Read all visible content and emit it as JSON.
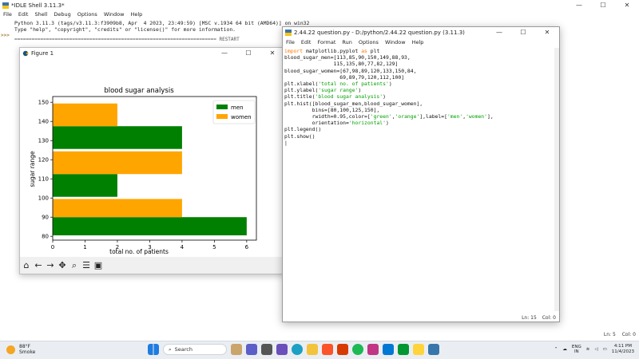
{
  "shell": {
    "title": "*IDLE Shell 3.11.3*",
    "menu": [
      "File",
      "Edit",
      "Shell",
      "Debug",
      "Options",
      "Window",
      "Help"
    ],
    "line1": "Python 3.11.3 (tags/v3.11.3:f3909b8, Apr  4 2023, 23:49:59) [MSC v.1934 64 bit (AMD64)] on win32",
    "line2": "Type \"help\", \"copyright\", \"credits\" or \"license()\" for more information.",
    "prompt": ">>>",
    "restart": "====================================================================== RESTART",
    "status_ln": "Ln: 5",
    "status_col": "Col: 0"
  },
  "figure": {
    "title": "Figure 1",
    "toolbar_icons": [
      "home-icon",
      "back-icon",
      "forward-icon",
      "pan-icon",
      "zoom-icon",
      "configure-icon",
      "save-icon"
    ]
  },
  "editor": {
    "title": "2.44.22 question.py - D:/python/2.44.22 question.py (3.11.3)",
    "menu": [
      "File",
      "Edit",
      "Format",
      "Run",
      "Options",
      "Window",
      "Help"
    ],
    "status_ln": "Ln: 15",
    "status_col": "Col: 0"
  },
  "chart_data": {
    "type": "bar",
    "orientation": "horizontal",
    "title": "blood sugar analysis",
    "xlabel": "total no. of patients",
    "ylabel": "sugar range",
    "xlim": [
      0,
      6.3
    ],
    "ylim": [
      78,
      153
    ],
    "x_ticks": [
      0,
      1,
      2,
      3,
      4,
      5,
      6
    ],
    "y_ticks": [
      80,
      90,
      100,
      110,
      120,
      130,
      140,
      150
    ],
    "bins": [
      80,
      100,
      125,
      150
    ],
    "series": [
      {
        "name": "men",
        "color": "#008000",
        "values": [
          6,
          2,
          4
        ]
      },
      {
        "name": "women",
        "color": "#ffa500",
        "values": [
          4,
          4,
          2
        ]
      }
    ],
    "rwidth": 0.95,
    "legend": "top-right"
  },
  "taskbar": {
    "temp": "88°F",
    "weather": "Smoke",
    "search": "Search",
    "lang1": "ENG",
    "lang2": "IN",
    "time": "4:11 PM",
    "date": "11/4/2023"
  }
}
